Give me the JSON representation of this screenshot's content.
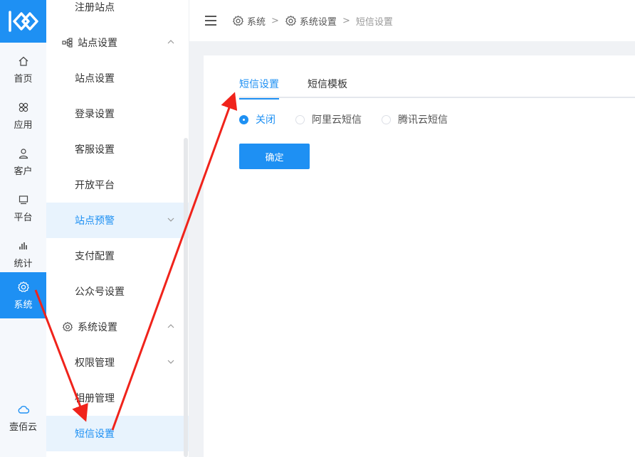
{
  "rail": {
    "items": [
      {
        "label": "首页",
        "icon": "home-icon"
      },
      {
        "label": "应用",
        "icon": "apps-icon"
      },
      {
        "label": "客户",
        "icon": "user-icon"
      },
      {
        "label": "平台",
        "icon": "monitor-icon"
      },
      {
        "label": "统计",
        "icon": "stats-icon"
      },
      {
        "label": "系统",
        "icon": "gear-icon",
        "active": true
      }
    ],
    "bottom": {
      "label": "壹佰云",
      "icon": "cloud-icon"
    }
  },
  "menu": {
    "items": [
      {
        "label": "注册站点"
      },
      {
        "label": "站点设置",
        "group": true,
        "icon": "sitemap-icon",
        "expanded": true
      },
      {
        "label": "站点设置"
      },
      {
        "label": "登录设置"
      },
      {
        "label": "客服设置"
      },
      {
        "label": "开放平台"
      },
      {
        "label": "站点预警",
        "highlight": true,
        "chevron": "down"
      },
      {
        "label": "支付配置"
      },
      {
        "label": "公众号设置"
      },
      {
        "label": "系统设置",
        "group": true,
        "icon": "gear-icon",
        "expanded": true
      },
      {
        "label": "权限管理",
        "chevron": "down"
      },
      {
        "label": "相册管理"
      },
      {
        "label": "短信设置",
        "highlight": true
      }
    ]
  },
  "breadcrumb": {
    "items": [
      {
        "label": "系统",
        "icon": "gear-icon"
      },
      {
        "label": "系统设置",
        "icon": "gear-icon"
      },
      {
        "label": "短信设置"
      }
    ],
    "separator": ">"
  },
  "tabs": [
    {
      "label": "短信设置",
      "active": true
    },
    {
      "label": "短信模板"
    }
  ],
  "radios": [
    {
      "label": "关闭",
      "checked": true
    },
    {
      "label": "阿里云短信"
    },
    {
      "label": "腾讯云短信"
    }
  ],
  "confirm_label": "确定",
  "colors": {
    "accent": "#1e90f3",
    "arrow": "#f0231b"
  }
}
